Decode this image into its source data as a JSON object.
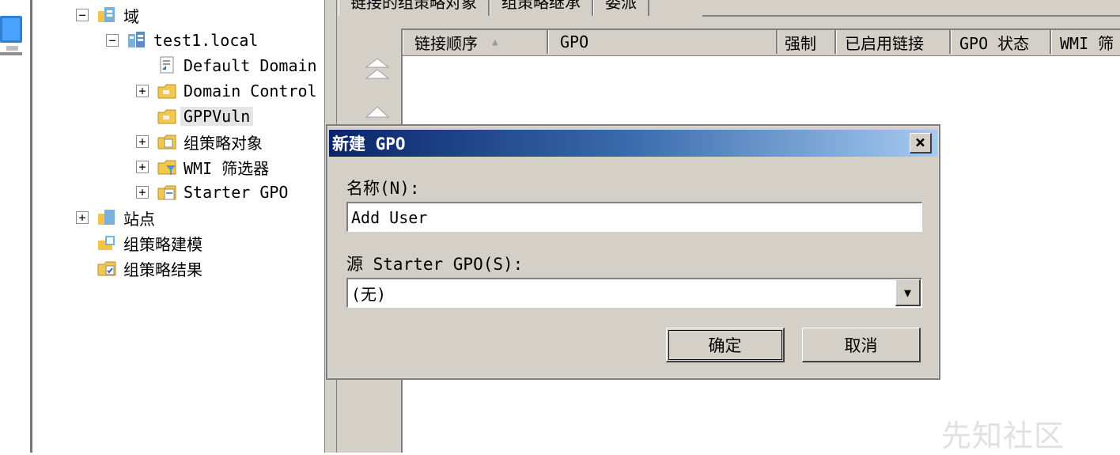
{
  "tree": {
    "domain_root": "域",
    "domain": "test1.local",
    "items": [
      {
        "label": "Default Domain"
      },
      {
        "label": "Domain Control"
      },
      {
        "label": "GPPVuln"
      },
      {
        "label": "组策略对象"
      },
      {
        "label": "WMI 筛选器"
      },
      {
        "label": "Starter GPO"
      }
    ],
    "sites": "站点",
    "modeling": "组策略建模",
    "results": "组策略结果"
  },
  "tabs": [
    {
      "label": "链接的组策略对象"
    },
    {
      "label": "组策略继承"
    },
    {
      "label": "委派"
    }
  ],
  "list_headers": [
    {
      "label": "链接顺序"
    },
    {
      "label": "GPO"
    },
    {
      "label": "强制"
    },
    {
      "label": "已启用链接"
    },
    {
      "label": "GPO 状态"
    },
    {
      "label": "WMI 筛"
    }
  ],
  "dialog": {
    "title": "新建 GPO",
    "name_label": "名称(N):",
    "name_value": "Add User",
    "source_label": "源 Starter GPO(S):",
    "source_value": "(无)",
    "ok": "确定",
    "cancel": "取消"
  },
  "watermark": "先知社区",
  "icons": {
    "domain-root": "domain-icon",
    "domain": "domain-network-icon",
    "item": "folder-icon"
  }
}
